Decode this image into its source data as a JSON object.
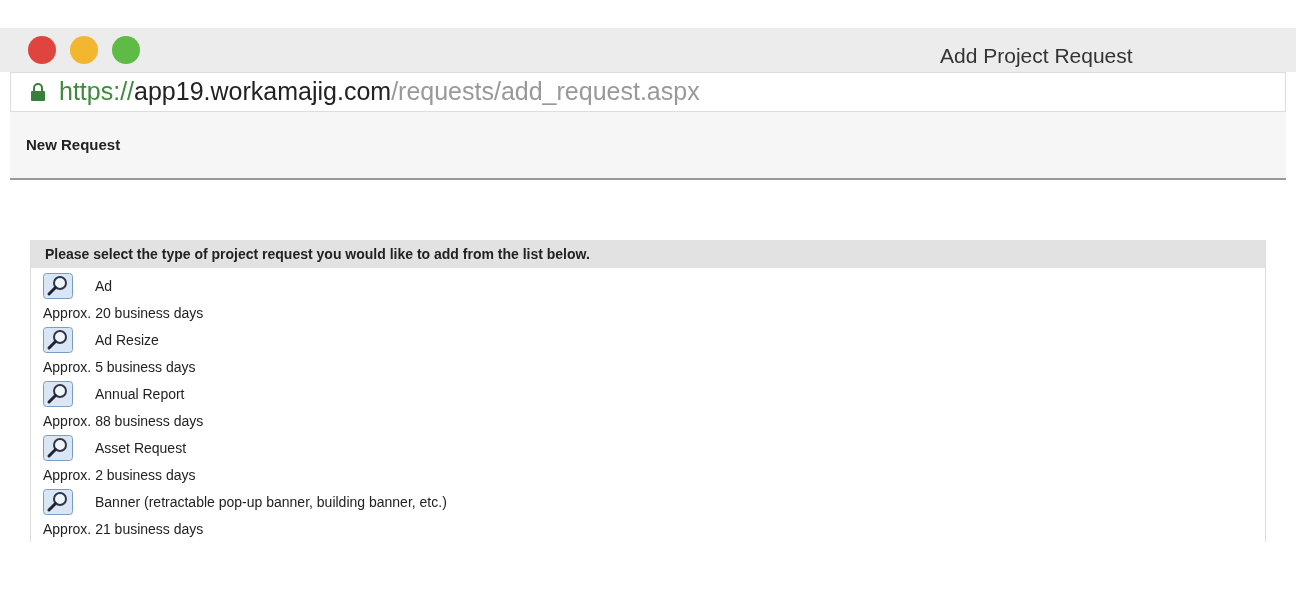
{
  "window": {
    "title": "Add Project Request"
  },
  "address_bar": {
    "scheme": "https://",
    "host": "app19.workamajig.com",
    "path": "/requests/add_request.aspx"
  },
  "page_header": "New Request",
  "request_types": {
    "instruction": "Please select the type of project request you would like to add from the list below.",
    "items": [
      {
        "name": "Ad",
        "duration": "Approx. 20 business days"
      },
      {
        "name": "Ad Resize",
        "duration": "Approx. 5 business days"
      },
      {
        "name": "Annual Report",
        "duration": "Approx. 88 business days"
      },
      {
        "name": "Asset Request",
        "duration": "Approx. 2 business days"
      },
      {
        "name": "Banner (retractable pop-up banner, building banner, etc.)",
        "duration": "Approx. 21 business days"
      }
    ]
  }
}
